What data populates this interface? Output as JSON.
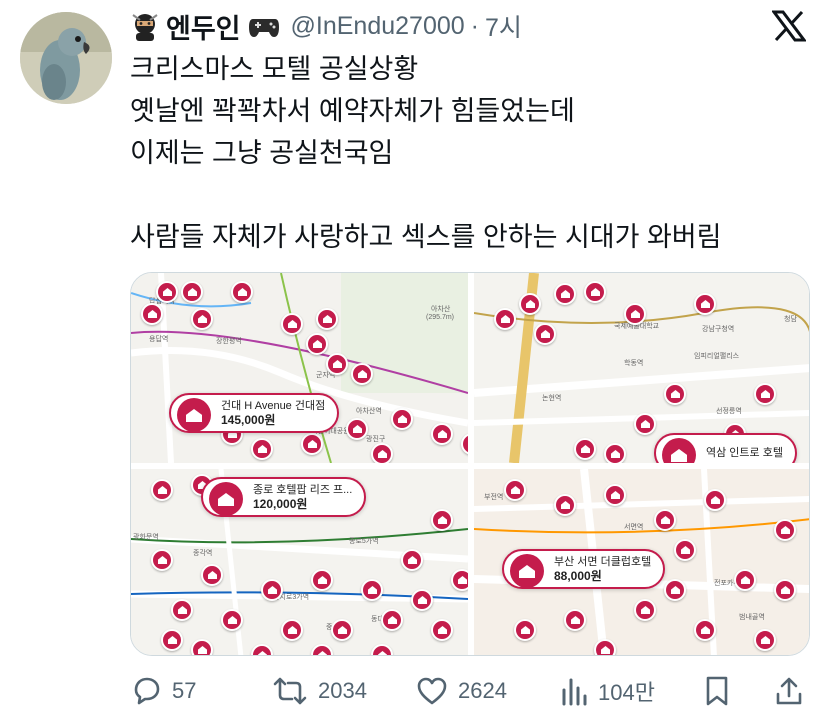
{
  "author": {
    "display_name": "엔두인",
    "handle": "@InEndu27000",
    "separator": "·",
    "time": "7시",
    "avatar_icon": "parrot-avatar",
    "prefix_icon": "ninja-emoji-icon",
    "suffix_icon": "game-controller-emoji-icon"
  },
  "tweet": {
    "lines": [
      "크리스마스 모텔 공실상황",
      "옛날엔 꽉꽉차서 예약자체가 힘들었는데",
      "이제는 그냥 공실천국임",
      "",
      "사람들 자체가 사랑하고 섹스를 안하는 시대가 와버림"
    ]
  },
  "media": {
    "tiles": [
      {
        "hotel_name": "건대 H Avenue 건대점",
        "price": "145,000원"
      },
      {
        "hotel_name": "역삼 인트로 호텔",
        "price": ""
      },
      {
        "hotel_name": "종로 호텔팝 리즈 프...",
        "price": "120,000원"
      },
      {
        "hotel_name": "부산 서면 더클럽호텔",
        "price": "88,000원"
      }
    ],
    "map_labels": {
      "tile1": [
        "답십리역",
        "용답역",
        "장한평역",
        "군자역",
        "아차산",
        "(295.7m)",
        "아차산역",
        "광진구",
        "어린이대공원"
      ],
      "tile2": [
        "국제예술대학교",
        "강남구청역",
        "임피리얼팰리스",
        "선정릉역",
        "논현역",
        "학동역",
        "청담"
      ],
      "tile3": [
        "광화문역",
        "종각역",
        "종로5가역",
        "을지로3가역",
        "중구",
        "동대문역"
      ],
      "tile4": [
        "서면역",
        "부전역",
        "범내골역",
        "전포카페거리"
      ]
    },
    "accent_color": "#c41c4c"
  },
  "actions": {
    "replies": "57",
    "retweets": "2034",
    "likes": "2624",
    "views": "104만"
  }
}
